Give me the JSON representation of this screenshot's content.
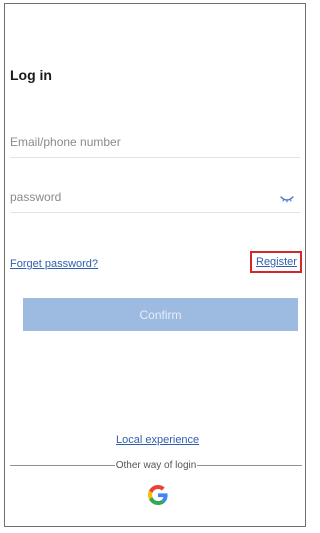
{
  "login": {
    "title": "Log in",
    "email_placeholder": "Email/phone number",
    "password_placeholder": "password",
    "forgot_password_label": "Forget password?",
    "register_label": "Register",
    "confirm_label": "Confirm",
    "local_experience_label": "Local experience",
    "other_login_label": "Other way of login",
    "password_toggle_icon": "eye-closed-icon",
    "social_icon": "google-icon"
  },
  "colors": {
    "link": "#2f5fae",
    "confirm_button_bg": "#9dbae1",
    "confirm_button_text": "#e6eef9",
    "highlight_border": "#d0282b",
    "field_divider": "#e3e3e3"
  }
}
